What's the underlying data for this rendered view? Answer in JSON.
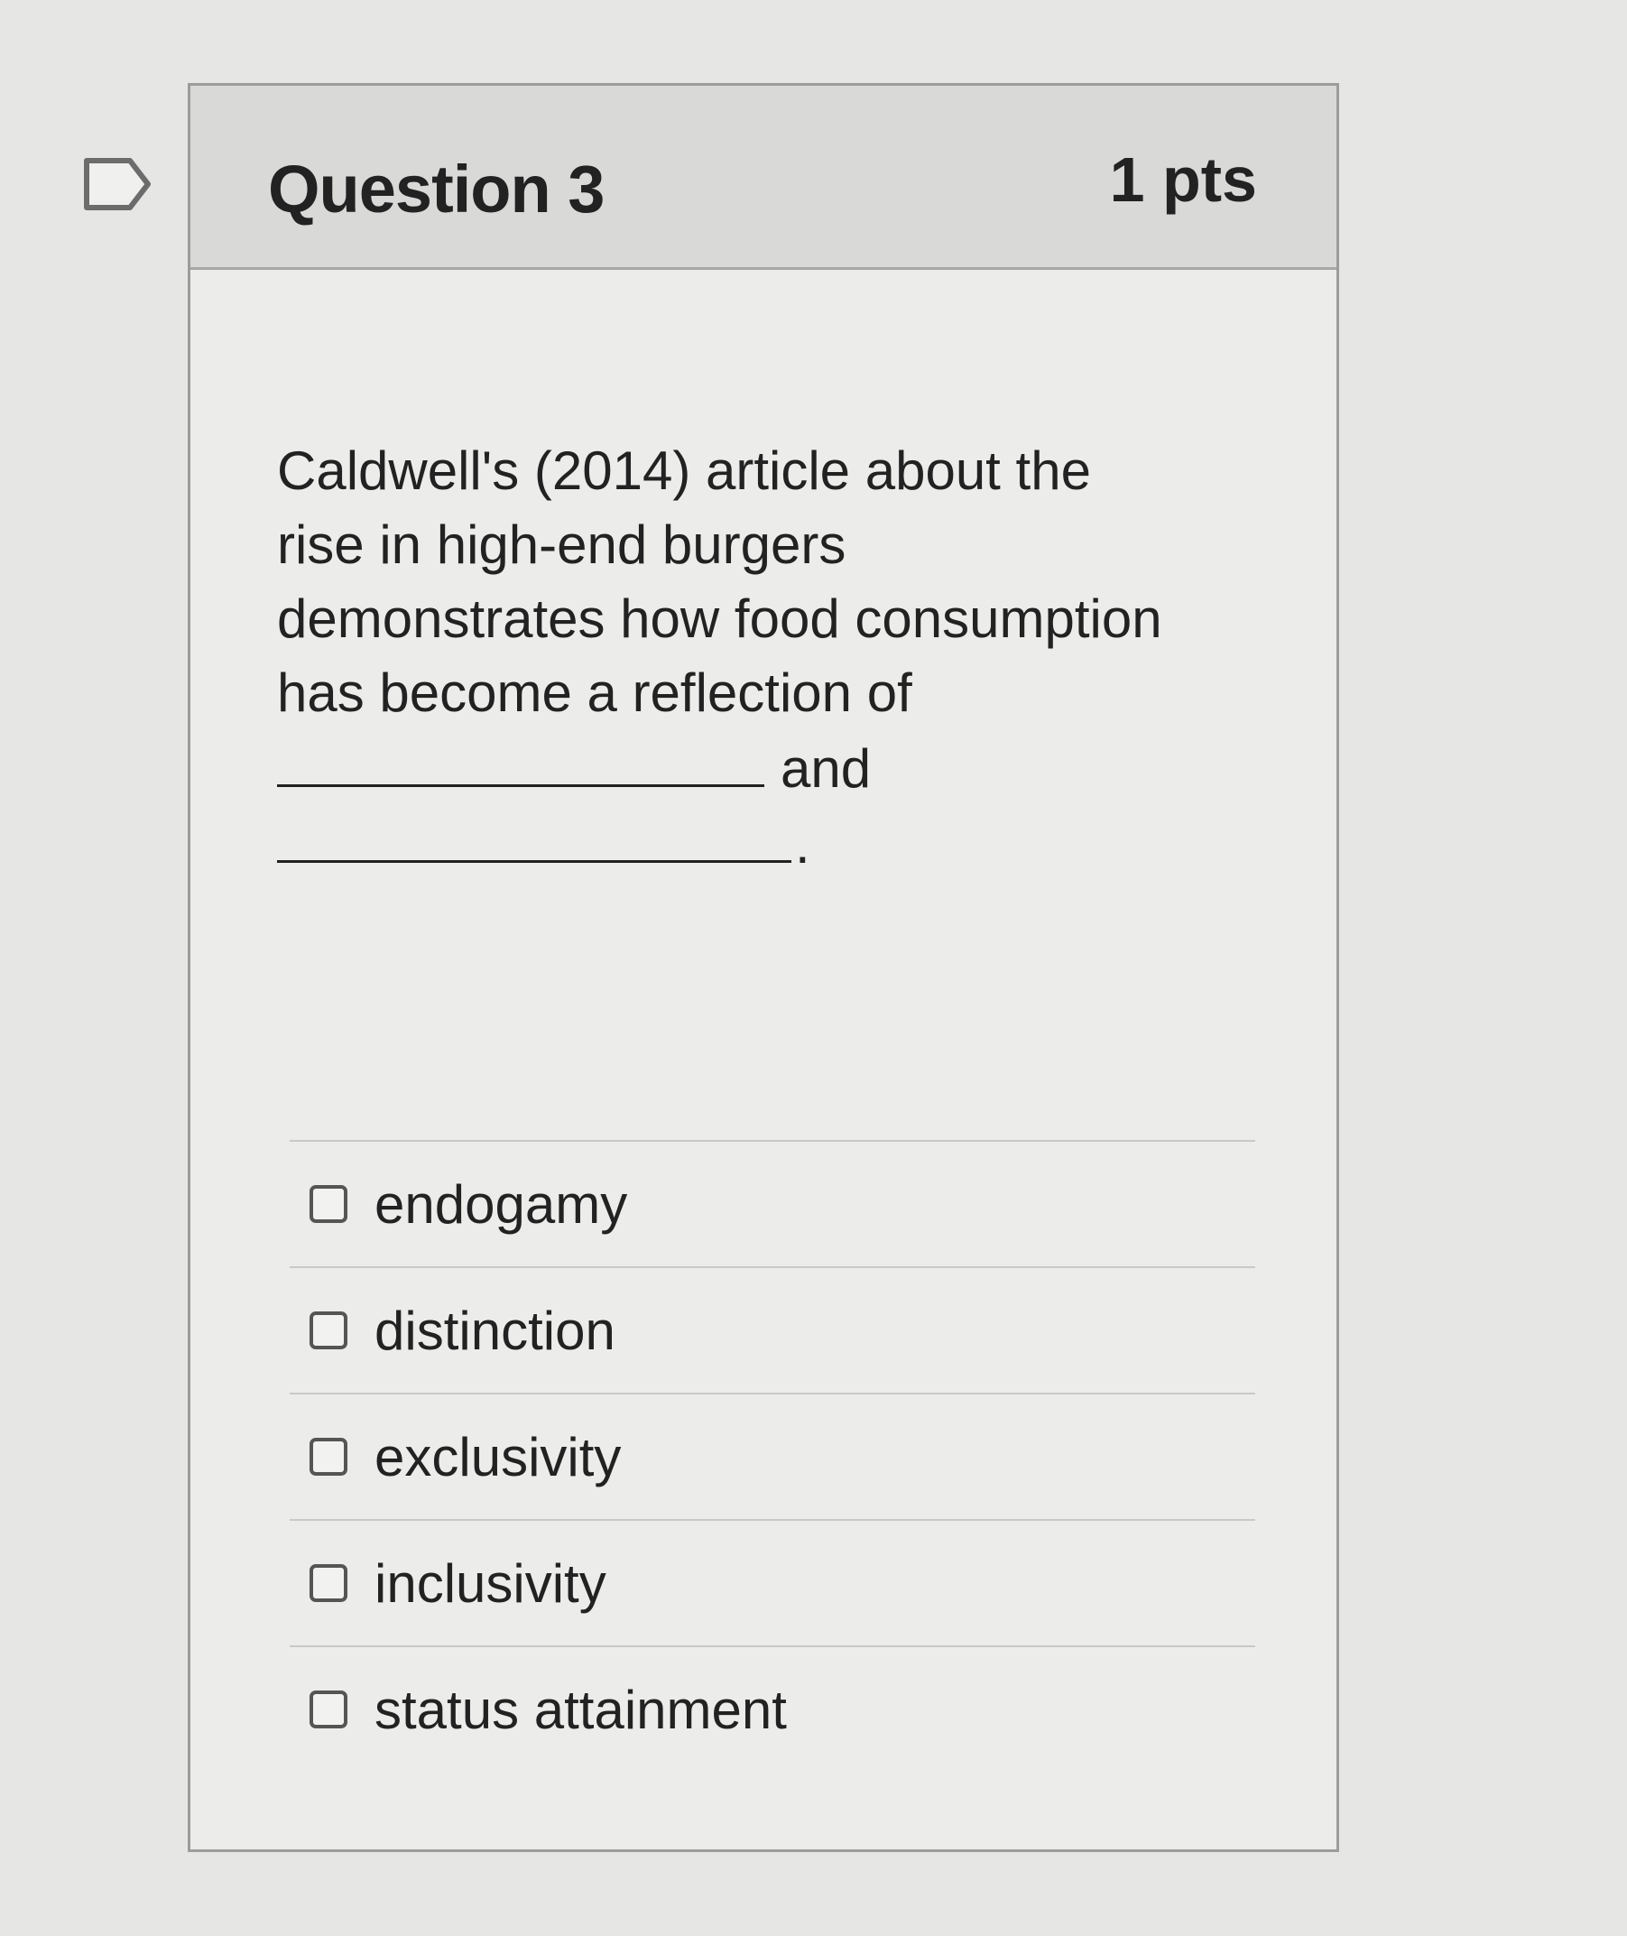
{
  "question": {
    "title": "Question 3",
    "points": "1 pts",
    "text_line1": "Caldwell's (2014) article about the",
    "text_line2": "rise in high-end burgers",
    "text_line3": "demonstrates how food consumption",
    "text_line4": "has become a reflection of",
    "connector": "and",
    "end_punct": "."
  },
  "answers": [
    {
      "label": "endogamy",
      "checked": false
    },
    {
      "label": "distinction",
      "checked": false
    },
    {
      "label": "exclusivity",
      "checked": false
    },
    {
      "label": "inclusivity",
      "checked": false
    },
    {
      "label": "status attainment",
      "checked": false
    }
  ],
  "icons": {
    "flag": "flag-question-icon"
  }
}
